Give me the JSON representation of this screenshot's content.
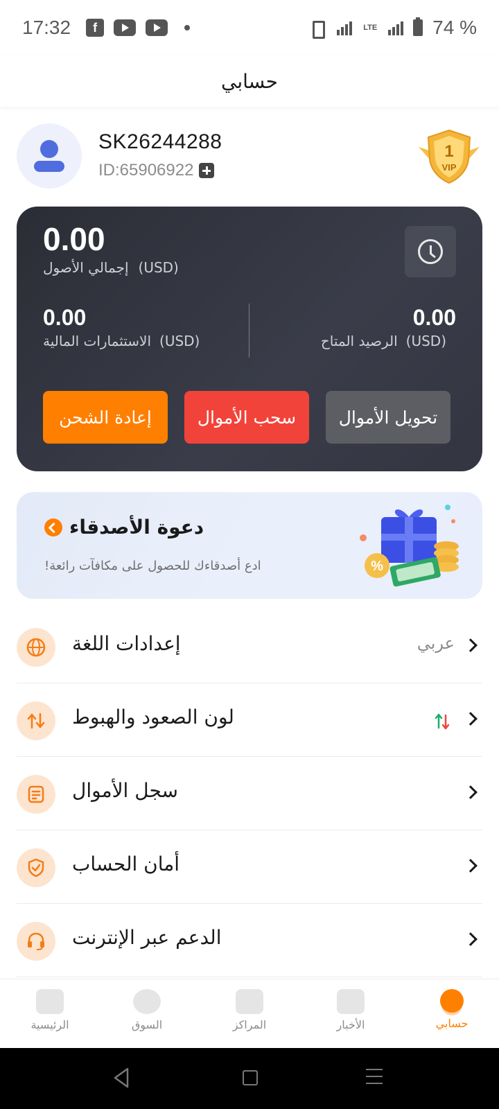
{
  "status_bar": {
    "time": "17:32",
    "battery": "74 %",
    "network": "LTE"
  },
  "header": {
    "title": "حسابي"
  },
  "profile": {
    "username": "SK26244288",
    "user_id": "ID:65906922",
    "vip_level": "1",
    "vip_label": "VIP"
  },
  "balance": {
    "total_value": "0.00",
    "total_label": "إجمالي الأصول",
    "total_currency": "(USD)",
    "invest_value": "0.00",
    "invest_label": "الاستثمارات المالية",
    "invest_currency": "(USD)",
    "available_value": "0.00",
    "available_label": "الرصيد المتاح",
    "available_currency": "(USD)",
    "btn_recharge": "إعادة الشحن",
    "btn_withdraw": "سحب الأموال",
    "btn_transfer": "تحويل الأموال"
  },
  "invite": {
    "title": "دعوة الأصدقاء",
    "subtitle": "!ادع أصدقاءك للحصول على مكافآت رائعة"
  },
  "menu": {
    "items": [
      {
        "label": "إعدادات اللغة",
        "value": "عربي",
        "icon": "globe-icon"
      },
      {
        "label": "لون الصعود والهبوط",
        "value": "",
        "icon": "up-down-arrows-icon"
      },
      {
        "label": "سجل الأموال",
        "value": "",
        "icon": "document-icon"
      },
      {
        "label": "أمان الحساب",
        "value": "",
        "icon": "shield-check-icon"
      },
      {
        "label": "الدعم عبر الإنترنت",
        "value": "",
        "icon": "headset-icon"
      }
    ]
  },
  "bottom_nav": {
    "items": [
      {
        "label": "الرئيسية",
        "icon": "home-icon"
      },
      {
        "label": "السوق",
        "icon": "market-icon"
      },
      {
        "label": "المراكز",
        "icon": "positions-icon"
      },
      {
        "label": "الأخبار",
        "icon": "news-icon"
      },
      {
        "label": "حسابي",
        "icon": "account-icon",
        "active": true
      }
    ]
  },
  "colors": {
    "accent": "#ff7f00",
    "withdraw": "#f2433a",
    "card_dark": "#2b2d36",
    "up": "#17b26a",
    "down": "#f2433a"
  }
}
